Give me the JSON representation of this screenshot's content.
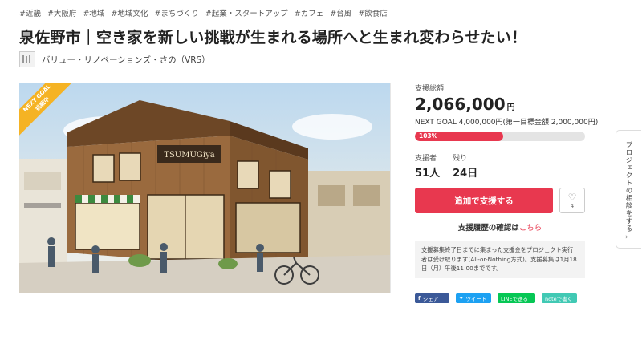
{
  "tags": [
    "#近畿",
    "#大阪府",
    "#地域",
    "#地域文化",
    "#まちづくり",
    "#起業・スタートアップ",
    "#カフェ",
    "#台風",
    "#飲食店"
  ],
  "title": "泉佐野市｜空き家を新しい挑戦が生まれる場所へと生まれ変わらせたい！",
  "owner": {
    "name": "バリュー・リノベーションズ・さの（VRS）"
  },
  "hero": {
    "ribbon_line1": "NEXT GOAL",
    "ribbon_line2": "挑戦中",
    "sign_text": "TSUMUGiya"
  },
  "funding": {
    "total_label": "支援総額",
    "amount": "2,066,000",
    "currency": "円",
    "next_goal": "NEXT GOAL 4,000,000円(第一目標金額 2,000,000円)",
    "percent_text": "103%",
    "progress_fraction": 0.52
  },
  "stats": {
    "supporters_label": "支援者",
    "supporters_value": "51人",
    "remaining_label": "残り",
    "remaining_value": "24日"
  },
  "actions": {
    "support_button": "追加で支援する",
    "favorite_count": "4"
  },
  "history": {
    "label": "支援履歴の確認は",
    "link": "こちら"
  },
  "notice": "支援募集終了日までに集まった支援金をプロジェクト実行者は受け取ります(All-or-Nothing方式)。支援募集は1月18日（月）午後11:00までです。",
  "share": {
    "facebook": "シェア",
    "twitter": "ツイート",
    "line": "LINEで送る",
    "note": "noteで書く"
  },
  "side_tab": {
    "label": "プロジェクトの相談をする",
    "arrow": "›"
  },
  "colors": {
    "accent": "#e8384f",
    "ribbon": "#f5b324"
  },
  "icons": {
    "favorite": "heart-icon",
    "share_facebook": "facebook-icon",
    "share_twitter": "twitter-icon"
  }
}
